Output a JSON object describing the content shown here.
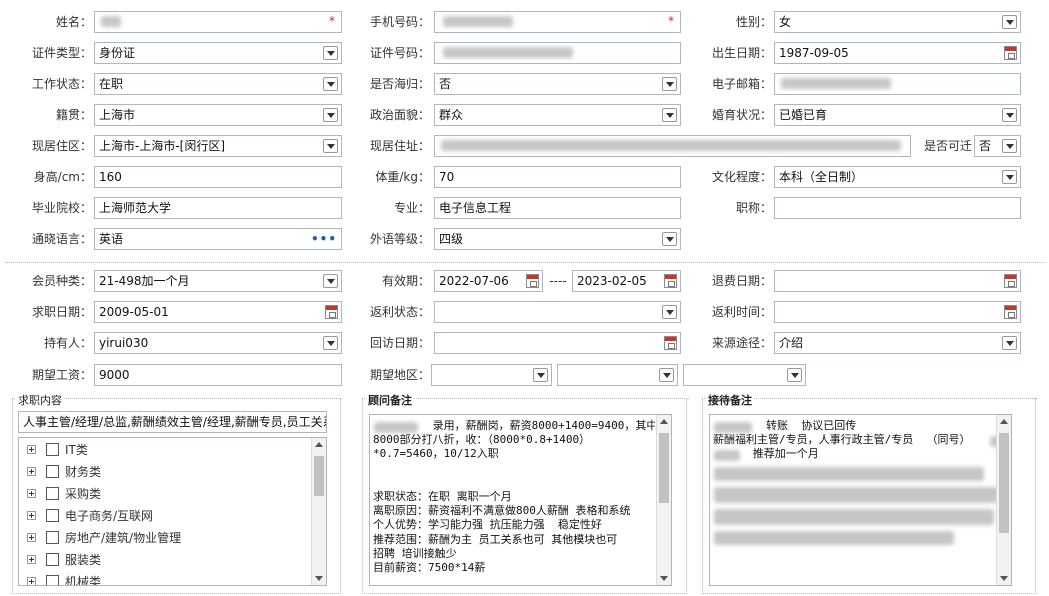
{
  "form": {
    "name": {
      "label": "姓名："
    },
    "phone": {
      "label": "手机号码："
    },
    "gender": {
      "label": "性别：",
      "value": "女"
    },
    "id_type": {
      "label": "证件类型：",
      "value": "身份证"
    },
    "id_no": {
      "label": "证件号码："
    },
    "birth": {
      "label": "出生日期：",
      "value": "1987-09-05"
    },
    "work_status": {
      "label": "工作状态：",
      "value": "在职"
    },
    "overseas": {
      "label": "是否海归：",
      "value": "否"
    },
    "email": {
      "label": "电子邮箱："
    },
    "native": {
      "label": "籍贯：",
      "value": "上海市"
    },
    "politics": {
      "label": "政治面貌：",
      "value": "群众"
    },
    "marriage": {
      "label": "婚育状况：",
      "value": "已婚已育"
    },
    "residence_area": {
      "label": "现居住区：",
      "value": "上海市-上海市-[闵行区]"
    },
    "residence_addr": {
      "label": "现居住址："
    },
    "relocate": {
      "label": "是否可迁",
      "value": "否"
    },
    "height": {
      "label": "身高/cm：",
      "value": "160"
    },
    "weight": {
      "label": "体重/kg：",
      "value": "70"
    },
    "education": {
      "label": "文化程度：",
      "value": "本科（全日制）"
    },
    "school": {
      "label": "毕业院校：",
      "value": "上海师范大学"
    },
    "major": {
      "label": "专业：",
      "value": "电子信息工程"
    },
    "title": {
      "label": "职称：",
      "value": ""
    },
    "language": {
      "label": "通晓语言：",
      "value": "英语",
      "more": "•••"
    },
    "lang_level": {
      "label": "外语等级：",
      "value": "四级"
    },
    "member_type": {
      "label": "会员种类：",
      "value": "21-498加一个月"
    },
    "valid": {
      "label": "有效期：",
      "from": "2022-07-06",
      "sep": "----",
      "to": "2023-02-05"
    },
    "refund_date": {
      "label": "退费日期：",
      "value": ""
    },
    "job_date": {
      "label": "求职日期：",
      "value": "2009-05-01"
    },
    "rebate_status": {
      "label": "返利状态：",
      "value": ""
    },
    "rebate_time": {
      "label": "返利时间：",
      "value": ""
    },
    "holder": {
      "label": "持有人：",
      "value": "yirui030"
    },
    "visit_date": {
      "label": "回访日期：",
      "value": ""
    },
    "source": {
      "label": "来源途径：",
      "value": "介绍"
    },
    "salary": {
      "label": "期望工资：",
      "value": "9000"
    },
    "region": {
      "label": "期望地区："
    }
  },
  "job_content": {
    "legend": "求职内容",
    "selected": "人事主管/经理/总监,薪酬绩效主管/经理,薪酬专员,员工关系",
    "tree": [
      "IT类",
      "财务类",
      "采购类",
      "电子商务/互联网",
      "房地产/建筑/物业管理",
      "服装类",
      "机械类"
    ]
  },
  "advisor": {
    "legend": "顾问备注",
    "text": "         录用，薪酬岗，薪资8000+1400=9400，其中\n8000部分打八折，收：（8000*0.8+1400）\n*0.7=5460，10/12入职\n\n\n求职状态：在职 离职一个月\n离职原因：薪资福利不满意做800人薪酬 表格和系统\n个人优势：学习能力强 抗压能力强  稳定性好\n推荐范围：薪酬为主 员工关系也可 其他模块也可\n招聘 培训接触少\n目前薪资：7500*14薪"
  },
  "reception": {
    "legend": "接待备注",
    "text": "        转账  协议已回传\n薪酬福利主管/专员，人事行政主管/专员  （同号）\n      推荐加一个月"
  },
  "icons": {
    "dropdown": "chevron-down-icon",
    "calendar": "calendar-icon",
    "expand": "plus-icon"
  },
  "colors": {
    "required": "#e02020",
    "border": "#a9b8c8",
    "link": "#2557a7"
  }
}
